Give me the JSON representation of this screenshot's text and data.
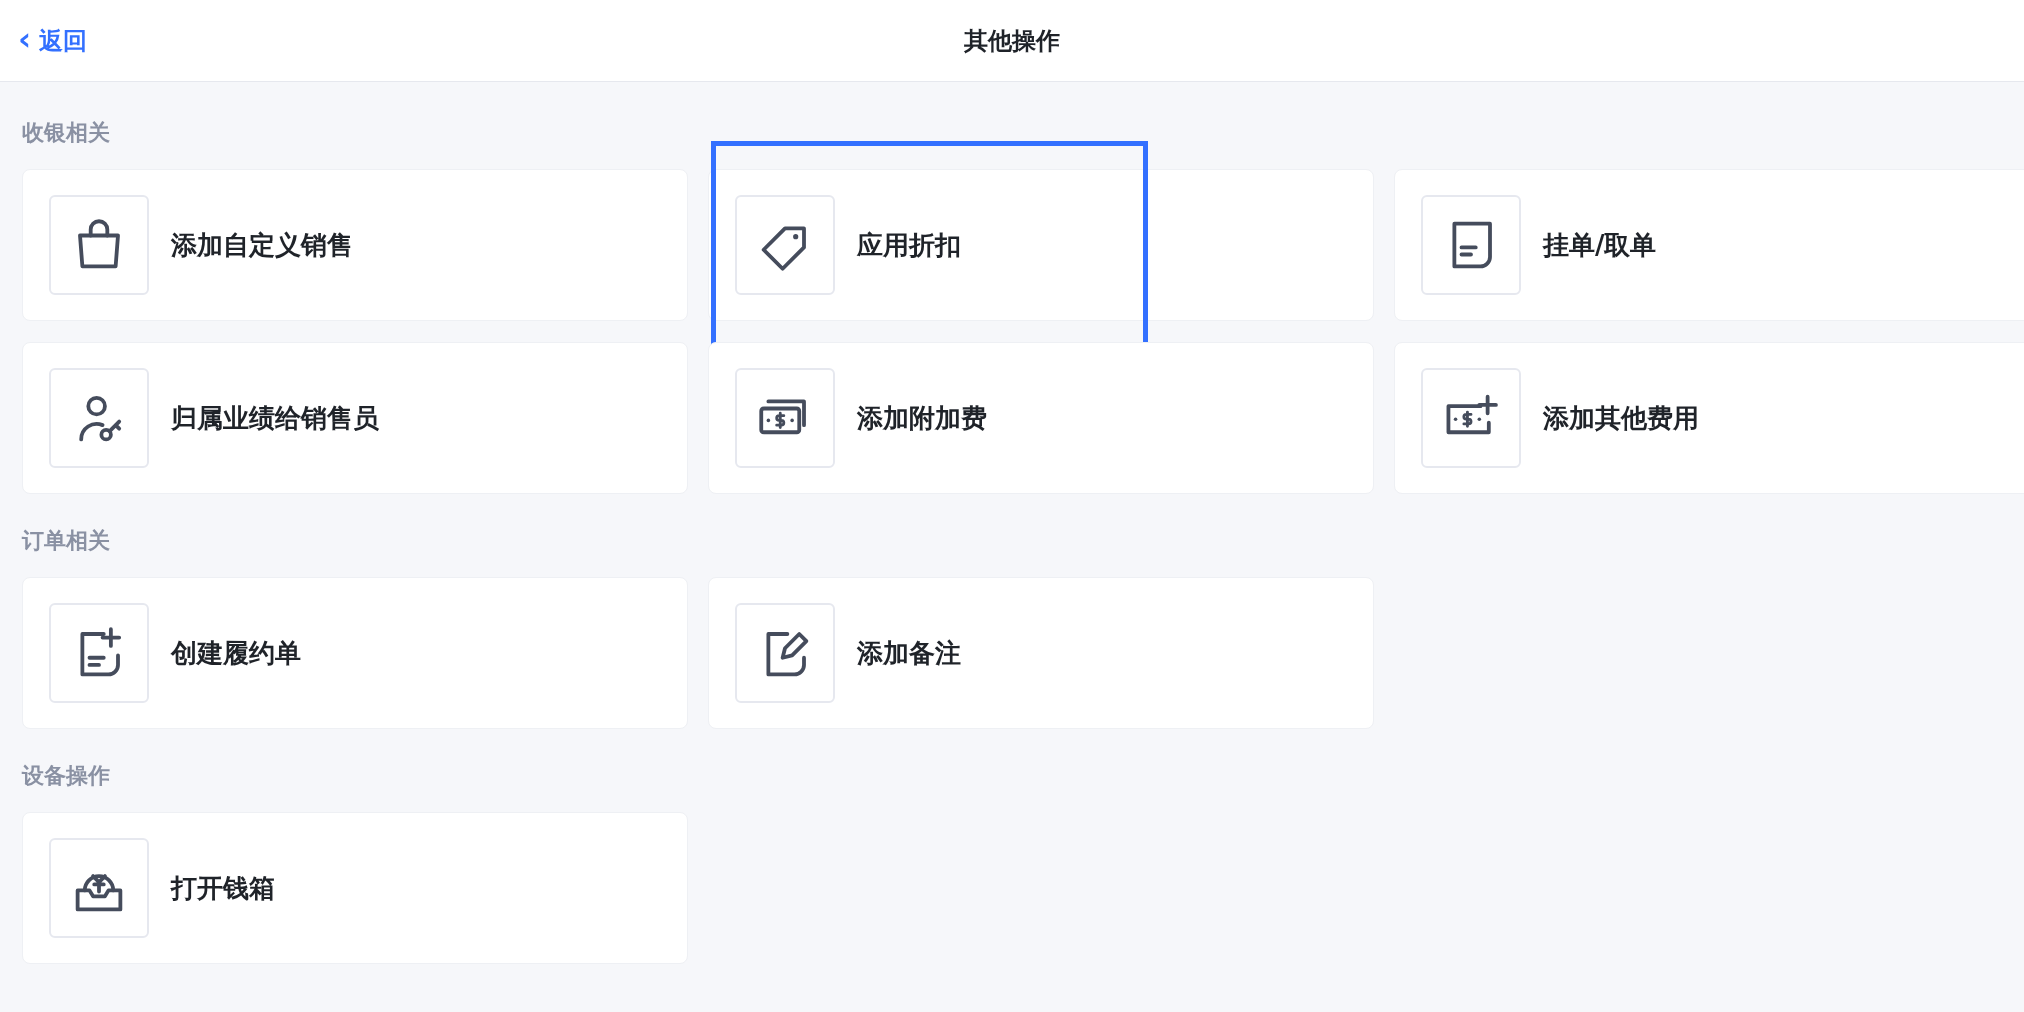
{
  "header": {
    "back": {
      "arrow": "‹",
      "label": "返回"
    },
    "title": "其他操作"
  },
  "sections": [
    {
      "title": "收银相关",
      "items": [
        {
          "label": "添加自定义销售",
          "highlighted": false
        },
        {
          "label": "应用折扣",
          "highlighted": true
        },
        {
          "label": "挂单/取单",
          "highlighted": false
        },
        {
          "label": "归属业绩给销售员",
          "highlighted": false
        },
        {
          "label": "添加附加费",
          "highlighted": false
        },
        {
          "label": "添加其他费用",
          "highlighted": false
        }
      ]
    },
    {
      "title": "订单相关",
      "items": [
        {
          "label": "创建履约单",
          "highlighted": false
        },
        {
          "label": "添加备注",
          "highlighted": false
        }
      ]
    },
    {
      "title": "设备操作",
      "items": [
        {
          "label": "打开钱箱",
          "highlighted": false
        }
      ]
    }
  ]
}
